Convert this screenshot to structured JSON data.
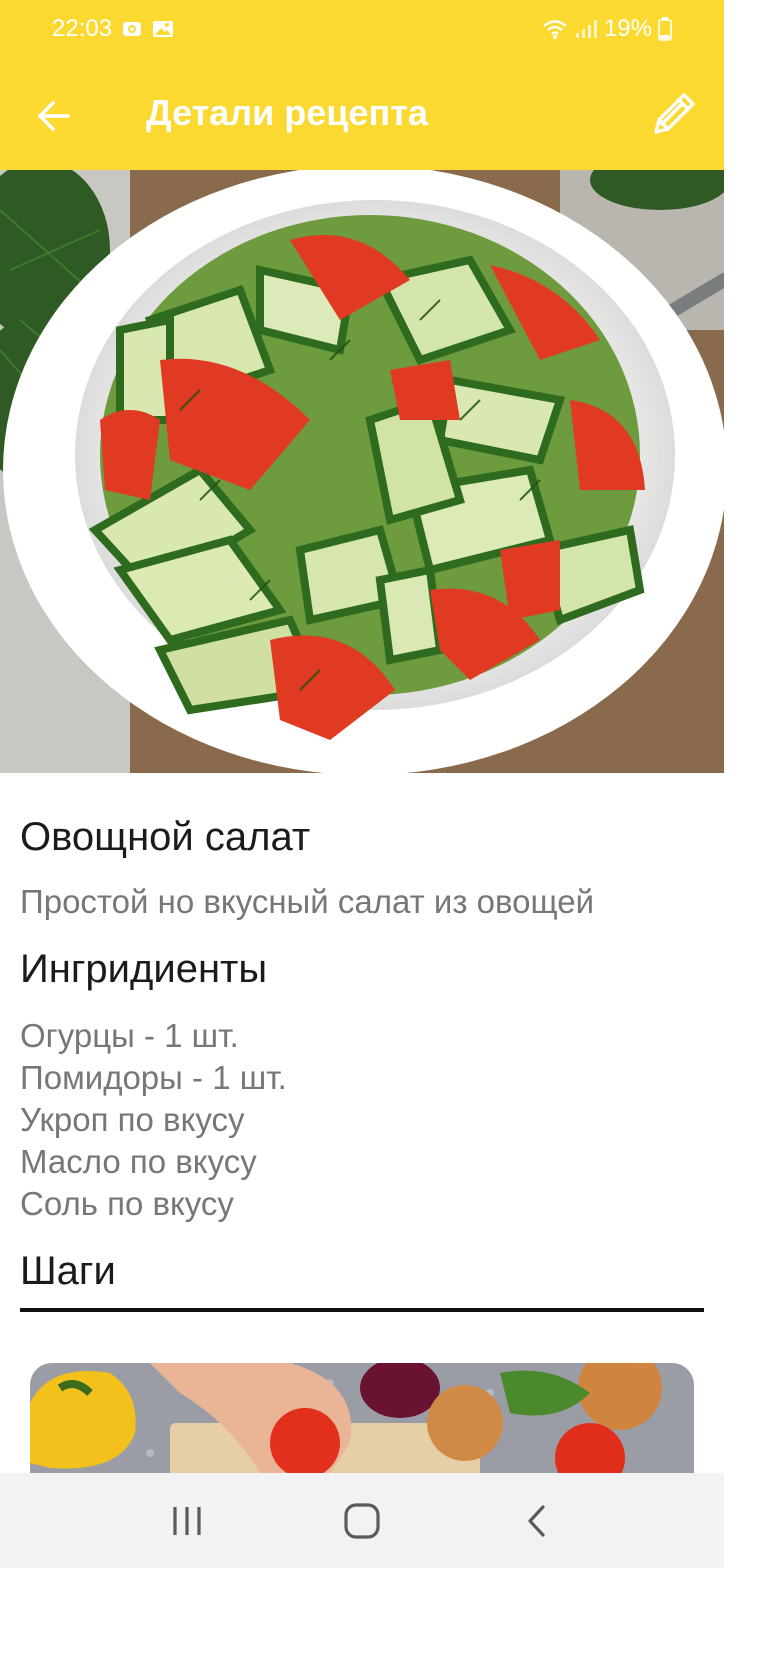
{
  "status_bar": {
    "time": "22:03",
    "battery": "19%",
    "icons": [
      "camera-notification-icon",
      "gallery-notification-icon",
      "wifi-icon",
      "signal-icon",
      "battery-icon"
    ]
  },
  "app_bar": {
    "title": "Детали рецепта",
    "back_icon": "arrow-back-icon",
    "edit_icon": "pencil-icon"
  },
  "recipe": {
    "title": "Овощной салат",
    "description": "Простой но вкусный салат из овощей",
    "ingredients_title": "Ингридиенты",
    "ingredients": [
      "Огурцы - 1 шт.",
      "Помидоры - 1 шт.",
      "Укроп по вкусу",
      "Масло по вкусу",
      "Соль по вкусу"
    ],
    "steps_title": "Шаги"
  },
  "nav_bar": {
    "icons": [
      "recents-icon",
      "home-icon",
      "back-nav-icon"
    ]
  },
  "colors": {
    "accent": "#fbd930",
    "title_text": "#1b1b1b",
    "secondary_text": "#777777",
    "nav_background": "#f2f2f2"
  }
}
